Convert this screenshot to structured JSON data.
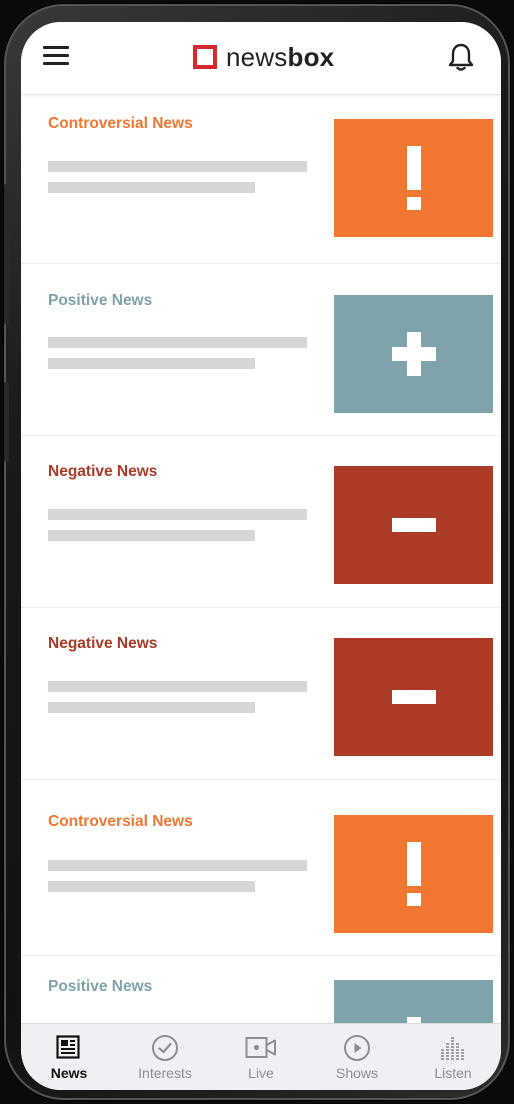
{
  "app": {
    "logo_prefix": "news",
    "logo_bold": "box",
    "brand_color": "#d7282f"
  },
  "header": {
    "menu_icon": "hamburger-menu-icon",
    "notification_icon": "bell-icon"
  },
  "feed": {
    "items": [
      {
        "category": "Controversial News",
        "kind": "controversial",
        "symbol": "exclamation-icon",
        "color": "#f07631"
      },
      {
        "category": "Positive News",
        "kind": "positive",
        "symbol": "plus-icon",
        "color": "#7ea3ab"
      },
      {
        "category": "Negative News",
        "kind": "negative",
        "symbol": "minus-icon",
        "color": "#ab3a27"
      },
      {
        "category": "Negative News",
        "kind": "negative",
        "symbol": "minus-icon",
        "color": "#ab3a27"
      },
      {
        "category": "Controversial News",
        "kind": "controversial",
        "symbol": "exclamation-icon",
        "color": "#f07631"
      },
      {
        "category": "Positive News",
        "kind": "positive",
        "symbol": "plus-icon",
        "color": "#7ea3ab"
      }
    ],
    "placeholder_color": "#d6d6d6"
  },
  "tabbar": {
    "tabs": [
      {
        "label": "News",
        "icon": "newspaper-icon",
        "active": true
      },
      {
        "label": "Interests",
        "icon": "checkmark-circle-icon",
        "active": false
      },
      {
        "label": "Live",
        "icon": "video-camera-icon",
        "active": false
      },
      {
        "label": "Shows",
        "icon": "play-circle-icon",
        "active": false
      },
      {
        "label": "Listen",
        "icon": "audio-bars-icon",
        "active": false
      }
    ]
  }
}
